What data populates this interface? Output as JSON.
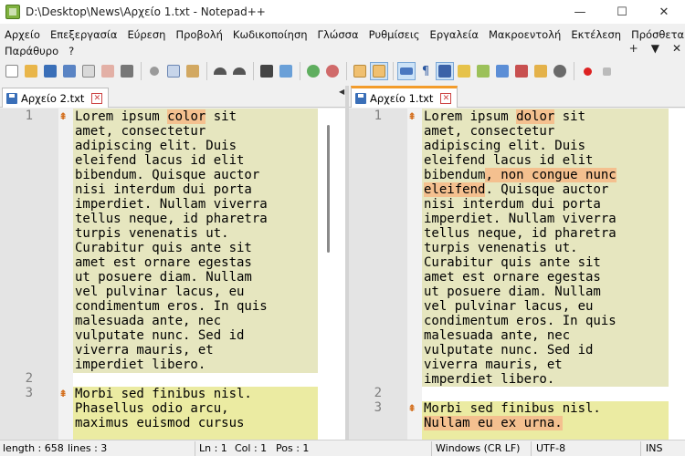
{
  "window": {
    "title": "D:\\Desktop\\News\\Αρχείο 1.txt - Notepad++",
    "minimize_glyph": "—",
    "maximize_glyph": "☐",
    "close_glyph": "✕"
  },
  "menu": {
    "items": [
      "Αρχείο",
      "Επεξεργασία",
      "Εύρεση",
      "Προβολή",
      "Κωδικοποίηση",
      "Γλώσσα",
      "Ρυθμίσεις",
      "Εργαλεία",
      "Μακροεντολή",
      "Εκτέλεση",
      "Πρόσθετα"
    ],
    "second_row": [
      "Παράθυρο",
      "?"
    ],
    "right_glyphs": [
      "+",
      "▼",
      "✕"
    ]
  },
  "tabs": {
    "left": {
      "label": "Αρχείο 2.txt"
    },
    "right": {
      "label": "Αρχείο 1.txt"
    }
  },
  "left_editor": {
    "line1": [
      "Lorem ipsum ",
      "color",
      " sit",
      "amet, consectetur",
      "adipiscing elit. Duis",
      "eleifend lacus id elit",
      "bibendum. Quisque auctor",
      "nisi interdum dui porta",
      "imperdiet. Nullam viverra",
      "tellus neque, id pharetra",
      "turpis venenatis ut.",
      "Curabitur quis ante sit",
      "amet est ornare egestas",
      "ut posuere diam. Nullam",
      "vel pulvinar lacus, eu",
      "condimentum eros. In quis",
      "malesuada ante, nec",
      "vulputate nunc. Sed id",
      "viverra mauris, et",
      "imperdiet libero."
    ],
    "line3": [
      "Morbi sed finibus nisl.",
      "Phasellus odio arcu,",
      "maximus euismod cursus"
    ],
    "line_numbers": [
      "1",
      "2",
      "3"
    ]
  },
  "right_editor": {
    "line1": [
      "Lorem ipsum ",
      "dolor",
      " sit",
      "amet, consectetur",
      "adipiscing elit. Duis",
      "eleifend lacus id elit",
      "bibendum",
      ", non congue nunc",
      "eleifend",
      ". Quisque auctor",
      "nisi interdum dui porta",
      "imperdiet. Nullam viverra",
      "tellus neque, id pharetra",
      "turpis venenatis ut.",
      "Curabitur quis ante sit",
      "amet est ornare egestas",
      "ut posuere diam. Nullam",
      "vel pulvinar lacus, eu",
      "condimentum eros. In quis",
      "malesuada ante, nec",
      "vulputate nunc. Sed id",
      "viverra mauris, et",
      "imperdiet libero."
    ],
    "line3": [
      "Morbi sed finibus nisl.",
      "Nullam eu ex urna."
    ],
    "line_numbers": [
      "1",
      "2",
      "3"
    ]
  },
  "status": {
    "length": "length : 658",
    "lines": "lines : 3",
    "ln": "Ln : 1",
    "col": "Col : 1",
    "pos": "Pos : 1",
    "eol": "Windows (CR LF)",
    "encoding": "UTF-8",
    "mode": "INS"
  },
  "colors": {
    "changed_bg": "#e6e6bf",
    "added_bg": "#ebeba2",
    "diff_word": "#f4c08f",
    "active_tab_accent": "#f39c2b"
  }
}
